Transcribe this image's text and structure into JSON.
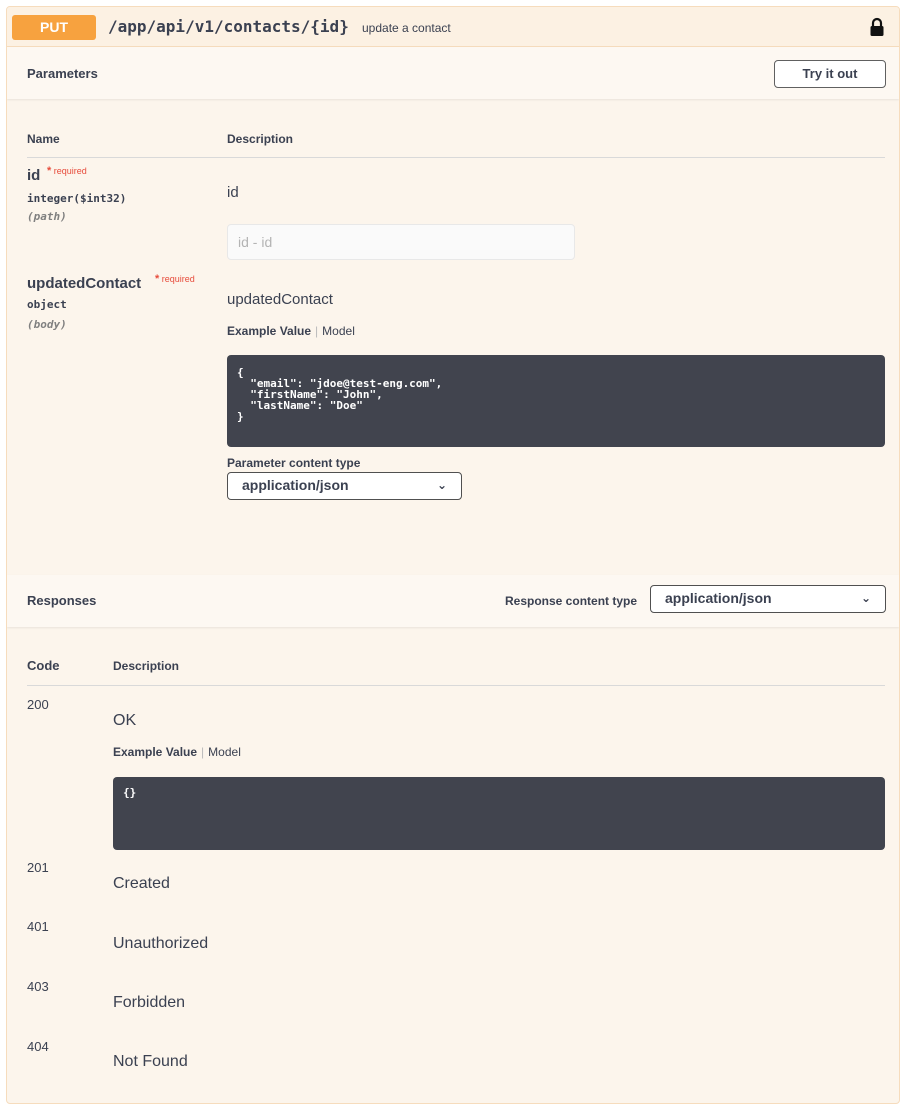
{
  "operation": {
    "method": "PUT",
    "path": "/app/api/v1/contacts/{id}",
    "summary": "update a contact",
    "lock_icon": "lock-icon"
  },
  "parameters": {
    "title": "Parameters",
    "try_it_out_label": "Try it out",
    "col_name": "Name",
    "col_description": "Description",
    "items": [
      {
        "name": "id",
        "required_marker": "*",
        "required_label": "required",
        "type": "integer($int32)",
        "location": "(path)",
        "description": "id",
        "input_placeholder": "id - id"
      },
      {
        "name": "updatedContact",
        "required_marker": "*",
        "required_label": "required",
        "type": "object",
        "location": "(body)",
        "description": "updatedContact",
        "tab_example": "Example Value",
        "tab_model": "Model",
        "example_json": "{\n  \"email\": \"jdoe@test-eng.com\",\n  \"firstName\": \"John\",\n  \"lastName\": \"Doe\"\n}",
        "content_type_label": "Parameter content type",
        "content_type_value": "application/json"
      }
    ]
  },
  "responses": {
    "title": "Responses",
    "content_type_label": "Response content type",
    "content_type_value": "application/json",
    "col_code": "Code",
    "col_description": "Description",
    "tab_example": "Example Value",
    "tab_model": "Model",
    "example_json": "{}",
    "items": [
      {
        "code": "200",
        "description": "OK"
      },
      {
        "code": "201",
        "description": "Created"
      },
      {
        "code": "401",
        "description": "Unauthorized"
      },
      {
        "code": "403",
        "description": "Forbidden"
      },
      {
        "code": "404",
        "description": "Not Found"
      }
    ]
  },
  "colors": {
    "put_accent": "#f7a23f",
    "panel_bg": "#fcf5ec",
    "code_bg": "#41444e",
    "required": "#e74c3c"
  }
}
